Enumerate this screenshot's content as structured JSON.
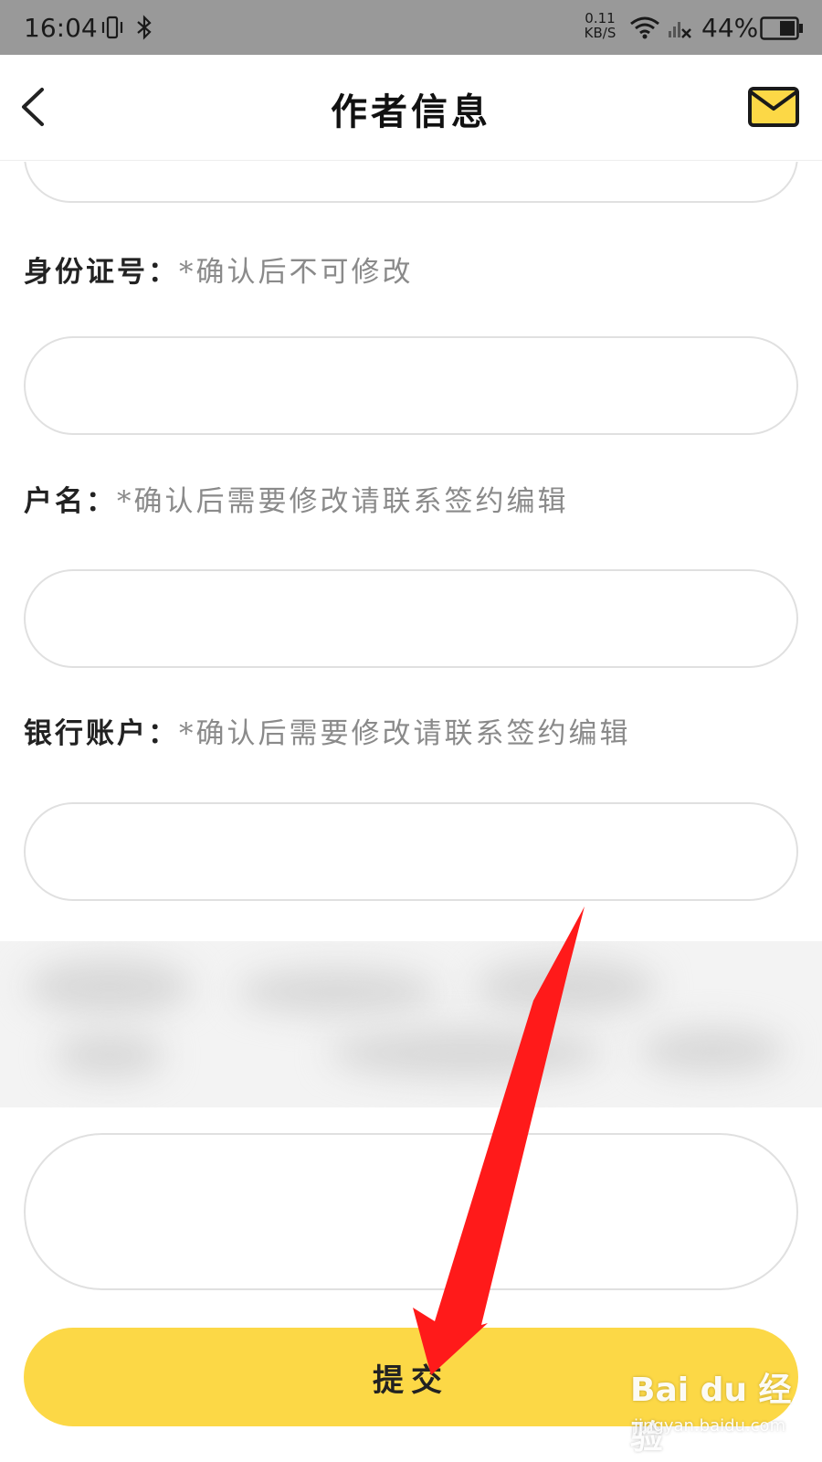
{
  "status_bar": {
    "time": "16:04",
    "net_speed_value": "0.11",
    "net_speed_unit": "KB/S",
    "battery_percent": "44%"
  },
  "nav": {
    "title": "作者信息",
    "back_icon": "chevron-left-icon",
    "mail_icon": "mail-icon",
    "mail_color": "#fcd846"
  },
  "form": {
    "id_number": {
      "label": "身份证号：",
      "note": "*确认后不可修改",
      "value": ""
    },
    "account_name": {
      "label": "户名：",
      "note": "*确认后需要修改请联系签约编辑",
      "value": ""
    },
    "bank_account": {
      "label": "银行账户：",
      "note": "*确认后需要修改请联系签约编辑",
      "value": ""
    },
    "address": {
      "value": ""
    }
  },
  "submit": {
    "label": "提交",
    "color": "#fcd846"
  },
  "annotation": {
    "arrow_color": "#ff1a1a"
  },
  "watermark": {
    "main": "Bai du 经验",
    "sub": "jingyan.baidu.com"
  }
}
